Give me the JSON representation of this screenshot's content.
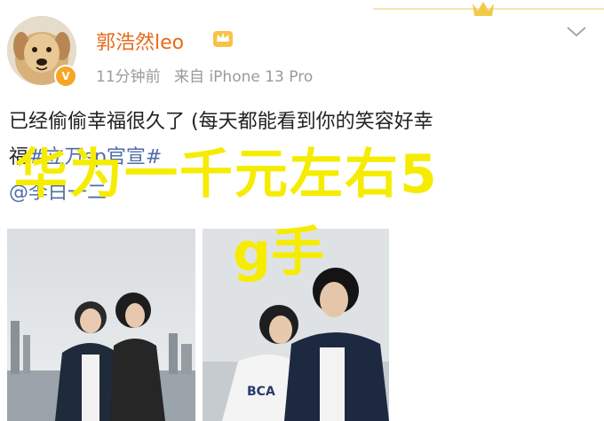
{
  "post": {
    "username": "郭浩然leo",
    "time": "11分钟前",
    "source": "来自 iPhone 13 Pro",
    "text_line1": "已经偷偷幸福很久了 (每天都能看到你的笑容好幸",
    "text_line2_start": "福",
    "hashtag": "#立万sp官宣#",
    "mention": "@李白一二"
  },
  "overlay": {
    "line1": "华为一千元左右5",
    "line2": "g手"
  },
  "icons": {
    "avatar": "dog-avatar",
    "verified": "verified-badge-icon",
    "vip": "crown-icon",
    "menu": "chevron-down-icon"
  },
  "colors": {
    "username": "#e86a1a",
    "link": "#4e6da8",
    "overlay_text": "#f5ec00",
    "meta": "#9a9a9a"
  }
}
